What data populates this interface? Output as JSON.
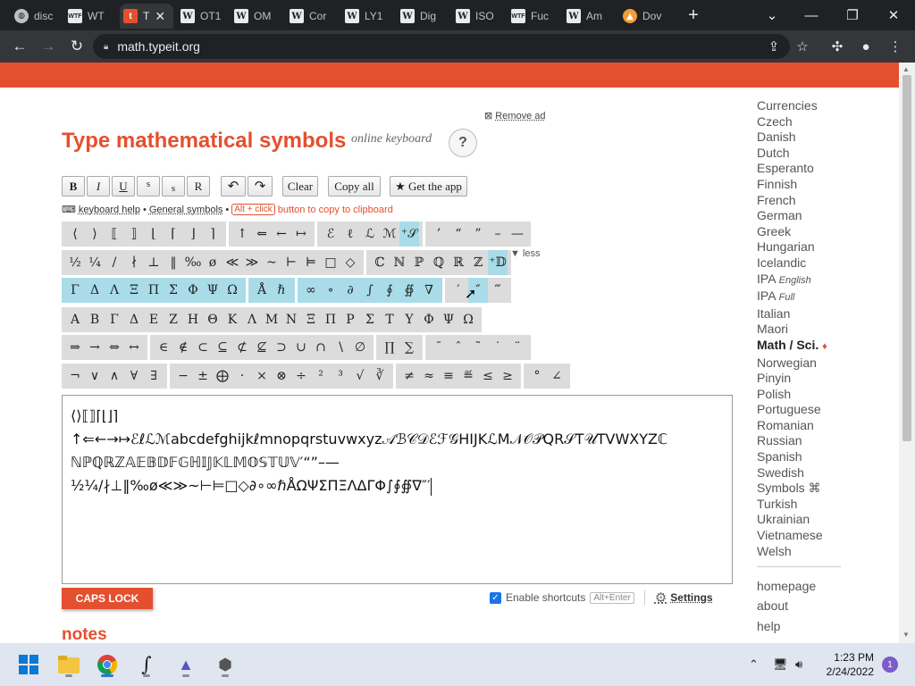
{
  "browser": {
    "tabs": [
      {
        "label": "disc",
        "favicon": "disc",
        "icon_name": "discord-icon"
      },
      {
        "label": "WT",
        "favicon": "WTF",
        "icon_name": "wtf-icon"
      },
      {
        "label": "T",
        "favicon": "t",
        "icon_name": "typeit-icon",
        "active": true
      },
      {
        "label": "OT1",
        "favicon": "W",
        "icon_name": "wikipedia-icon"
      },
      {
        "label": "OM",
        "favicon": "W",
        "icon_name": "wikipedia-icon"
      },
      {
        "label": "Cor",
        "favicon": "W",
        "icon_name": "wikipedia-icon"
      },
      {
        "label": "LY1",
        "favicon": "W",
        "icon_name": "wikipedia-icon"
      },
      {
        "label": "Dig",
        "favicon": "W",
        "icon_name": "wikipedia-icon"
      },
      {
        "label": "ISO",
        "favicon": "W",
        "icon_name": "wikipedia-icon"
      },
      {
        "label": "Fuc",
        "favicon": "WTF",
        "icon_name": "wtf-icon"
      },
      {
        "label": "Am",
        "favicon": "W",
        "icon_name": "wikipedia-icon"
      },
      {
        "label": "Dov",
        "favicon": "▲",
        "icon_name": "download-site-icon"
      }
    ],
    "new_tab": "+",
    "url": "math.typeit.org"
  },
  "page": {
    "remove_ad": "Remove ad",
    "remove_ad_icon": "⊠",
    "title": "Type mathematical symbols",
    "subtitle": "online keyboard",
    "help": "?",
    "toolbar": {
      "bold": "B",
      "italic": "I",
      "underline": "U",
      "sup": "s",
      "sub": "s",
      "roman": "R",
      "undo": "↶",
      "redo": "↷",
      "clear": "Clear",
      "copy_all": "Copy all",
      "get_app": "★ Get the app"
    },
    "helpline": {
      "keyboard_help": "keyboard help",
      "bullet": "•",
      "general_symbols": "General symbols",
      "alt_click": "Alt + click",
      "hint": "button to copy to clipboard"
    },
    "less": "▼ less",
    "keyboard_rows": [
      [
        {
          "keys": [
            "⟨",
            "⟩",
            "⟦",
            "⟧",
            "⌊",
            "⌈",
            "⌋",
            "⌉"
          ]
        },
        {
          "keys": [
            "↑",
            "⇐",
            "←",
            "↦"
          ]
        },
        {
          "keys": [
            "ℰ",
            "ℓ",
            "ℒ",
            "ℳ",
            "⁺𝒮"
          ]
        },
        {
          "keys": [
            "’",
            "“",
            "”",
            "–",
            "—"
          ]
        }
      ],
      [
        {
          "keys": [
            "½",
            "¼",
            "/",
            "∤",
            "⊥",
            "‖",
            "‰",
            "ø",
            "≪",
            "≫",
            "~",
            "⊢",
            "⊨",
            "□",
            "◇"
          ]
        },
        {
          "keys": [
            "ℂ",
            "ℕ",
            "ℙ",
            "ℚ",
            "ℝ",
            "ℤ",
            "⁺𝔻"
          ]
        }
      ],
      [
        {
          "keys": [
            "Γ",
            "Δ",
            "Λ",
            "Ξ",
            "Π",
            "Σ",
            "Φ",
            "Ψ",
            "Ω"
          ],
          "blue": true
        },
        {
          "keys": [
            "Å",
            "ℏ"
          ],
          "blue": true
        },
        {
          "keys": [
            "∞",
            "∘",
            "∂",
            "∫",
            "∮",
            "∯",
            "∇"
          ],
          "blue": true
        },
        {
          "keys": [
            "′",
            "″",
            "‴"
          ]
        }
      ],
      [
        {
          "keys": [
            "Α",
            "Β",
            "Γ",
            "Δ",
            "Ε",
            "Ζ",
            "Η",
            "Θ",
            "Κ",
            "Λ",
            "Μ",
            "Ν",
            "Ξ",
            "Π",
            "Ρ",
            "Σ",
            "Τ",
            "Υ",
            "Φ",
            "Ψ",
            "Ω"
          ]
        }
      ],
      [
        {
          "keys": [
            "⇒",
            "→",
            "⇔",
            "↔"
          ]
        },
        {
          "keys": [
            "∈",
            "∉",
            "⊂",
            "⊆",
            "⊄",
            "⊈",
            "⊃",
            "∪",
            "∩",
            "∖",
            "∅"
          ]
        },
        {
          "keys": [
            "∏",
            "∑"
          ]
        },
        {
          "keys": [
            "¯",
            "ˆ",
            "˜",
            "˙",
            "¨"
          ]
        }
      ],
      [
        {
          "keys": [
            "¬",
            "∨",
            "∧",
            "∀",
            "∃"
          ]
        },
        {
          "keys": [
            "−",
            "±",
            "⨁",
            "·",
            "×",
            "⊗",
            "÷",
            "²",
            "³",
            "√",
            "∛"
          ]
        },
        {
          "keys": [
            "≠",
            "≈",
            "≡",
            "≝",
            "≤",
            "≥"
          ]
        },
        {
          "keys": [
            "°",
            "∠"
          ]
        }
      ]
    ],
    "editor_lines": [
      "⟨⟩⟦⟧⌈⌊⌋⌉",
      "↑⇐←→↦ℰℓℒℳabcdefghijkℓmnopqrstuvwxyz𝒜ℬ𝒞𝒟ℰℱ𝒢HIJKℒM𝒩𝒪𝒫QR𝒮T𝒰TVWXYZℂ",
      "ℕℙℚℝℤ𝔸𝔼𝔹𝔻𝔽𝔾ℍ𝕀𝕁𝕂𝕃𝕄𝕆𝕊𝕋𝕌𝕍′“”–—",
      "½¼/∤⊥‖‰ø≪≫~⊢⊨□◇∂∘∞ℏÅΩΨΣΠΞΛΔΓΦ∫∮∯∇″′"
    ],
    "caps_lock": "CAPS LOCK",
    "enable_shortcuts": "Enable shortcuts",
    "alt_enter": "Alt+Enter",
    "settings": "Settings",
    "notes": "notes"
  },
  "sidebar": {
    "languages": [
      "Currencies",
      "Czech",
      "Danish",
      "Dutch",
      "Esperanto",
      "Finnish",
      "French",
      "German",
      "Greek",
      "Hungarian",
      "Icelandic",
      "IPA",
      "IPA",
      "Italian",
      "Maori",
      "Math / Sci.",
      "Norwegian",
      "Pinyin",
      "Polish",
      "Portuguese",
      "Romanian",
      "Russian",
      "Spanish",
      "Swedish",
      "Symbols ⌘",
      "Turkish",
      "Ukrainian",
      "Vietnamese",
      "Welsh"
    ],
    "ipa_english": "English",
    "ipa_full": "Full",
    "active": "Math / Sci.",
    "active_marker": "♦",
    "footer": [
      "homepage",
      "about",
      "help"
    ]
  },
  "taskbar": {
    "time": "1:23 PM",
    "date": "2/24/2022",
    "notifications": "1"
  }
}
